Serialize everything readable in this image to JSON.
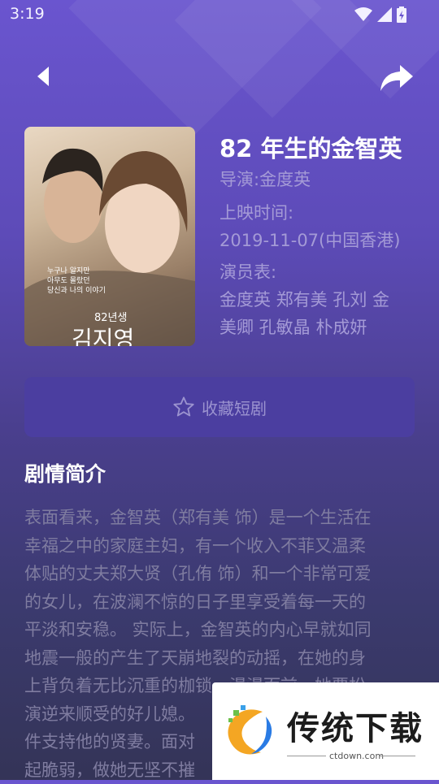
{
  "status": {
    "time": "3:19"
  },
  "movie": {
    "title": "82 年生的金智英",
    "director": "导演:金度英",
    "release_label": "上映时间:",
    "release_value": "2019-11-07(中国香港)",
    "cast_label": "演员表:",
    "cast_line1": "金度英 郑有美 孔刘 金",
    "cast_line2": "美卿 孔敏晶 朴成妍",
    "poster_text": {
      "korean_tagline1": "누구나 알지만",
      "korean_tagline2": "아무도 몰랐던",
      "korean_tagline3": "당신과 나의 이야기",
      "korean_year": "82년생",
      "korean_name": "김지영"
    }
  },
  "actions": {
    "favorite_label": "收藏短剧"
  },
  "synopsis": {
    "title": "剧情简介",
    "lines": [
      "表面看来，金智英（郑有美 饰）是一个生活在",
      "幸福之中的家庭主妇，有一个收入不菲又温柔",
      "体贴的丈夫郑大贤（孔侑 饰）和一个非常可爱",
      "的女儿，在波澜不惊的日子里享受着每一天的",
      "平淡和安稳。 实际上，金智英的内心早就如同",
      "地震一般的产生了天崩地裂的动摇，在她的身",
      "上背负着无比沉重的枷锁，漫漫而前，她要扮",
      "演逆来顺受的好儿媳。",
      "件支持他的贤妻。面对",
      "起脆弱，做她无坚不摧"
    ]
  },
  "watermark": {
    "brand": "传统下载",
    "url": "ctdown.com"
  },
  "icons": {
    "back": "back-arrow-icon",
    "share": "share-icon",
    "star": "star-icon",
    "wifi": "wifi-icon",
    "signal": "signal-icon",
    "battery": "battery-icon"
  },
  "colors": {
    "accent_purple": "#6a55cf",
    "button_bg": "#4b3ea0",
    "muted_text": "#a49ad6"
  }
}
